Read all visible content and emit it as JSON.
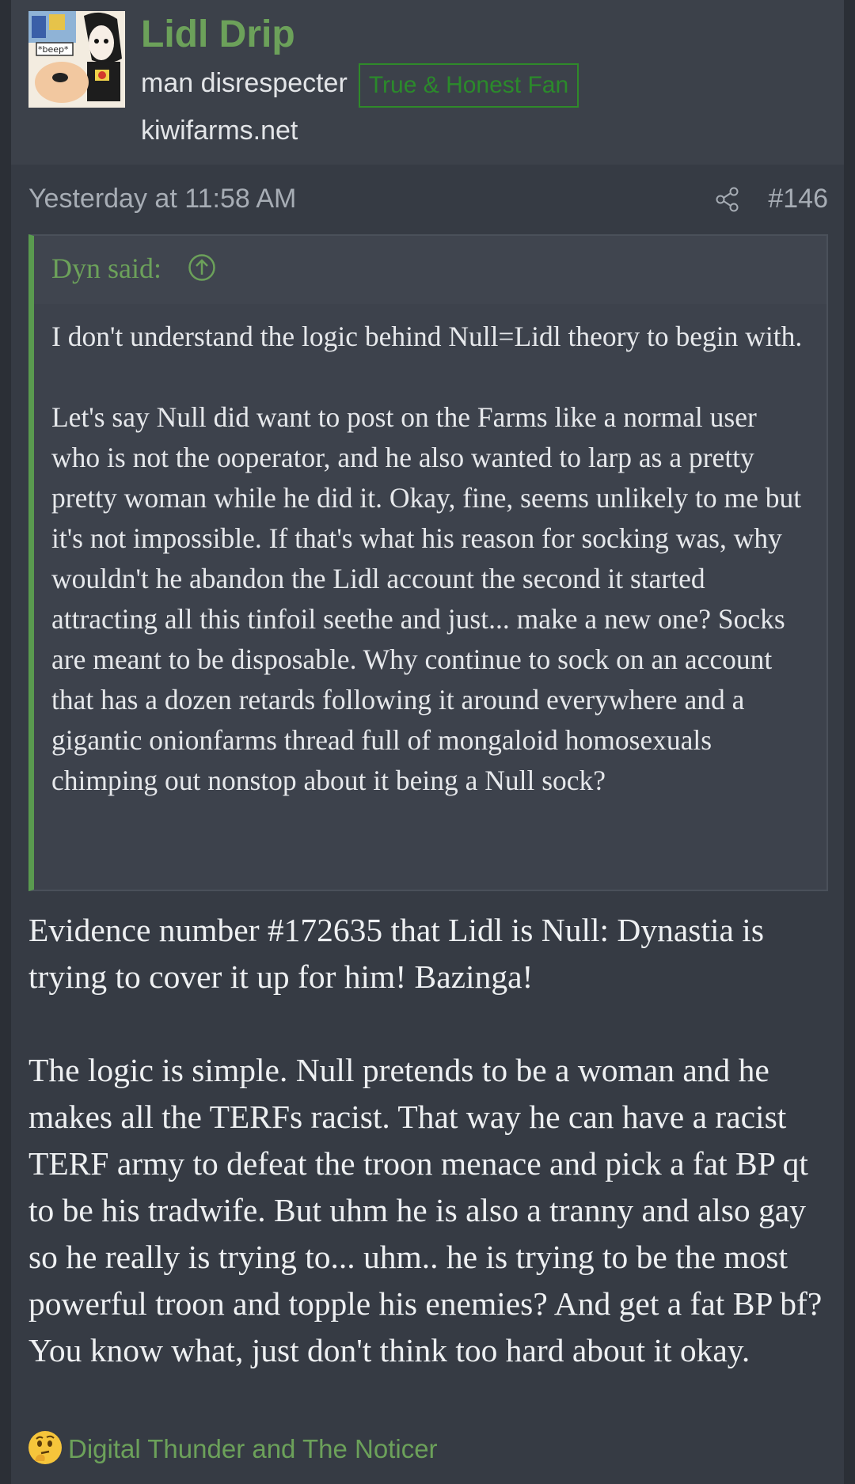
{
  "user": {
    "name": "Lidl Drip",
    "title": "man disrespecter",
    "badge": "True & Honest Fan",
    "site": "kiwifarms.net",
    "avatar_text": "*beep*"
  },
  "post": {
    "time": "Yesterday at 11:58 AM",
    "number": "#146",
    "quote": {
      "author": "Dyn said:",
      "text": "I don't understand the logic behind Null=Lidl theory to begin with.\n\nLet's say Null did want to post on the Farms like a normal user who is not the ooperator, and he also wanted to larp as a pretty pretty woman while he did it. Okay, fine, seems unlikely to me but it's not impossible. If that's what his reason for socking was, why wouldn't he abandon the Lidl account the second it started attracting all this tinfoil seethe and just... make a new one? Socks are meant to be disposable. Why continue to sock on an account that has a dozen retards following it around everywhere and a gigantic onionfarms thread full of mongaloid homosexuals chimping out nonstop about it being a Null sock?"
    },
    "body": "Evidence number #172635 that Lidl is Null: Dynastia is trying to cover it up for him! Bazinga!\n\nThe logic is simple. Null pretends to be a woman and he makes all the TERFs racist. That way he can have a racist TERF army to defeat the troon menace and pick a fat BP qt to be his tradwife. But uhm he is also a tranny and also gay so he really is trying to... uhm.. he is trying to be the most powerful troon and topple his enemies? And get a fat BP bf? You know what, just don't think too hard about it okay."
  },
  "reactions": {
    "emoji": "thinking-face-icon",
    "users": "Digital Thunder and The Noticer"
  },
  "colors": {
    "accent_green": "#6ca15a",
    "badge_green": "#2b8a2b",
    "background": "#363b44"
  }
}
